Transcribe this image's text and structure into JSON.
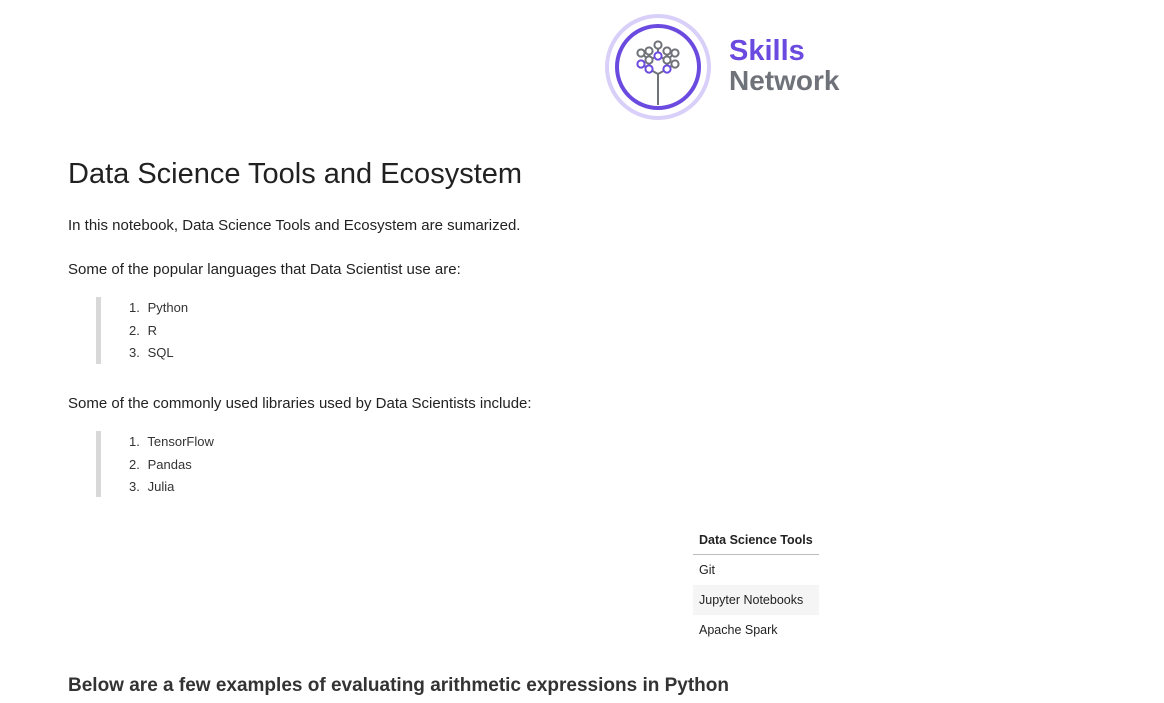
{
  "logo": {
    "line1": "Skills",
    "line2": "Network",
    "colors": {
      "purple": "#6b4ae0",
      "ring": "#d9d0fa",
      "gray": "#6f7379"
    }
  },
  "notebook": {
    "title": "Data Science Tools and Ecosystem",
    "intro": "In this notebook, Data Science Tools and Ecosystem are sumarized.",
    "languages_intro": "Some of the popular languages that Data Scientist use are:",
    "languages": [
      {
        "num": "1.",
        "name": "Python"
      },
      {
        "num": "2.",
        "name": "R"
      },
      {
        "num": "3.",
        "name": "SQL"
      }
    ],
    "libraries_intro": "Some of the commonly used libraries used by Data Scientists include:",
    "libraries": [
      {
        "num": "1.",
        "name": "TensorFlow"
      },
      {
        "num": "2.",
        "name": "Pandas"
      },
      {
        "num": "3.",
        "name": "Julia"
      }
    ],
    "table": {
      "header": "Data Science Tools",
      "rows": [
        "Git",
        "Jupyter Notebooks",
        "Apache Spark"
      ]
    },
    "arithmetic_heading": "Below are a few examples of evaluating arithmetic expressions in Python"
  }
}
